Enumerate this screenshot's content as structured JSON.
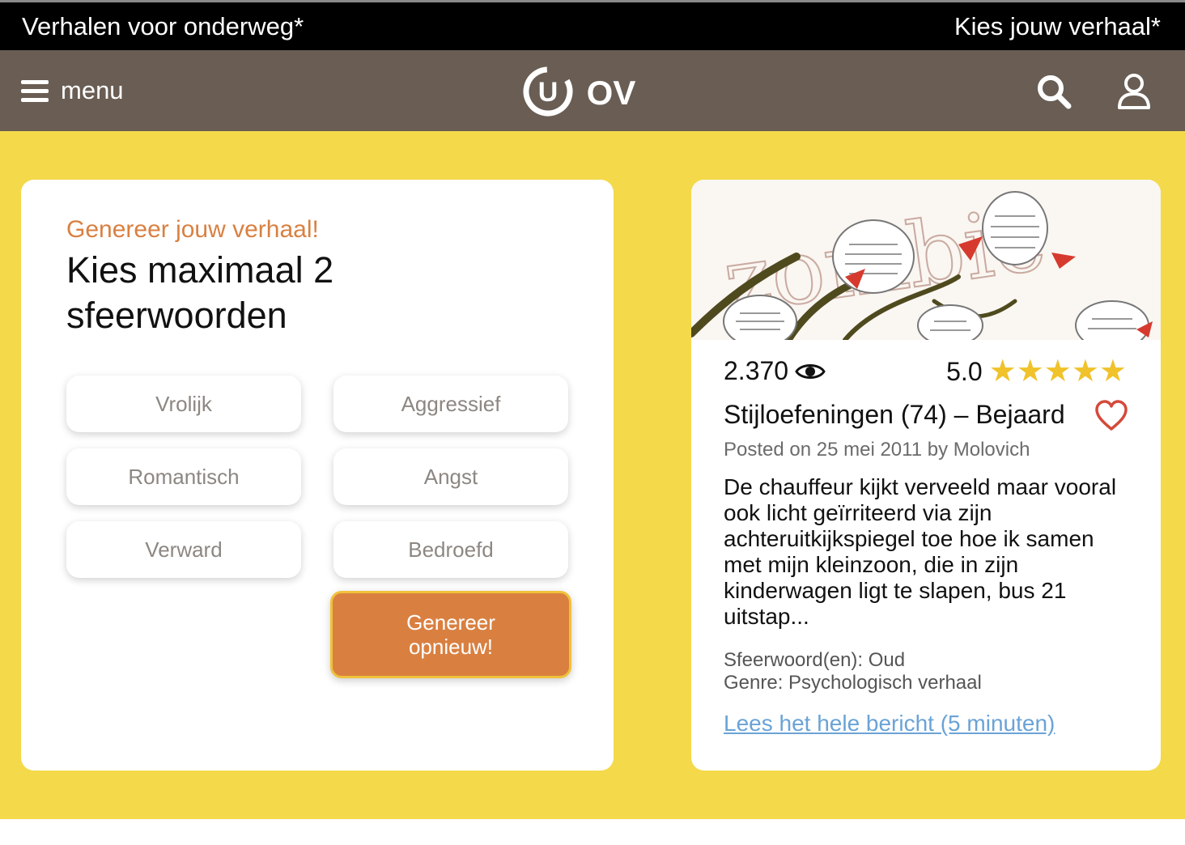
{
  "topbar": {
    "left_text": "Verhalen voor onderweg*",
    "right_text": "Kies jouw verhaal*"
  },
  "nav": {
    "menu_label": "menu",
    "logo_text": "OV",
    "logo_letter": "U",
    "icons": [
      "hamburger-icon",
      "search-icon",
      "user-icon"
    ]
  },
  "generator": {
    "subtitle": "Genereer jouw verhaal!",
    "title": "Kies maximaal 2 sfeerwoorden",
    "moods": [
      "Vrolijk",
      "Aggressief",
      "Romantisch",
      "Angst",
      "Verward",
      "Bedroefd"
    ],
    "button_line1": "Genereer",
    "button_line2": "opnieuw!"
  },
  "post": {
    "image_word": "zombie",
    "views": "2.370",
    "rating": "5.0",
    "stars": 5,
    "title": "Stijloefeningen (74) – Bejaard",
    "posted": "Posted on 25 mei 2011 by Molovich",
    "excerpt": "De chauffeur kijkt verveeld maar vooral ook licht geïrriteerd via zijn achteruitkijkspiegel toe hoe ik samen met mijn kleinzoon, die in zijn kinderwagen ligt te slapen, bus 21 uitstap...",
    "moods_line": "Sfeerwoord(en): Oud",
    "genre_line": "Genre: Psychologisch verhaal",
    "read_more": "Lees het hele bericht (5 minuten)"
  },
  "colors": {
    "topbar_bg": "#000000",
    "navbar_bg": "#695d54",
    "page_bg": "#f4d94a",
    "accent_orange": "#d98041",
    "star_yellow": "#f0c22b",
    "heart_red": "#d44a3a",
    "link_blue": "#6aa3d6"
  }
}
